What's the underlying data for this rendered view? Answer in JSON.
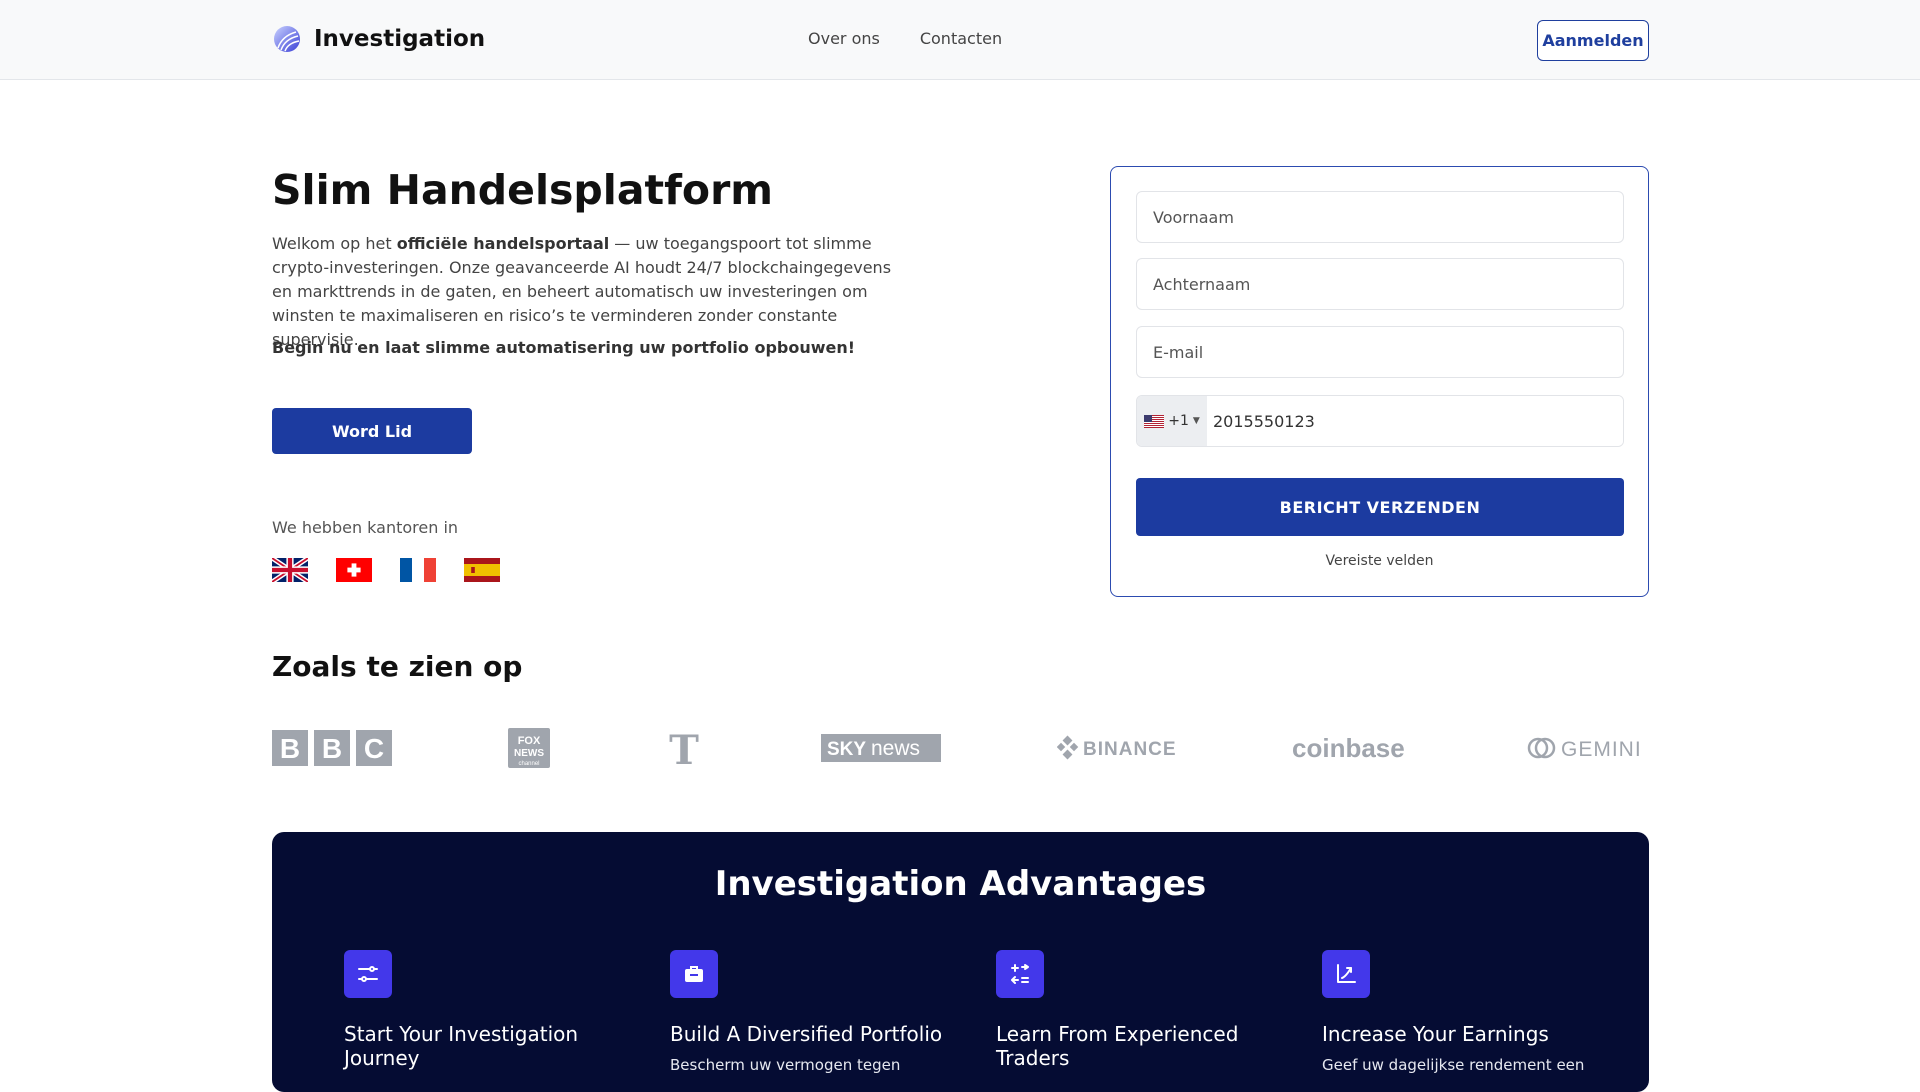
{
  "header": {
    "brand": "Investigation",
    "nav": [
      "Over ons",
      "Contacten"
    ],
    "login_label": "Aanmelden"
  },
  "hero": {
    "title": "Slim Handelsplatform",
    "intro_pre": "Welkom op het ",
    "intro_bold": "officiële handelsportaal",
    "intro_post": " — uw toegangspoort tot slimme crypto-investeringen. Onze geavanceerde AI houdt 24/7 blockchaingegevens en markttrends in de gaten, en beheert automatisch uw investeringen om winsten te maximaliseren en risico’s te verminderen zonder constante supervisie.",
    "cta_text": "Begin nu en laat slimme automatisering uw portfolio opbouwen!",
    "join_label": "Word Lid",
    "offices_label": "We hebben kantoren in"
  },
  "form": {
    "first_name_placeholder": "Voornaam",
    "last_name_placeholder": "Achternaam",
    "email_placeholder": "E-mail",
    "phone_code": "+1",
    "phone_value": "2015550123",
    "submit_label": "BERICHT VERZENDEN",
    "required_note": "Vereiste velden"
  },
  "seen_on": {
    "title": "Zoals te zien op",
    "logos": [
      "BBC",
      "FOX NEWS channel",
      "T",
      "SKY news",
      "BINANCE",
      "coinbase",
      "GEMINI"
    ]
  },
  "advantages": {
    "title": "Investigation Advantages",
    "items": [
      {
        "title": "Start Your Investigation Journey",
        "text": "",
        "icon": "sliders-icon"
      },
      {
        "title": "Build A Diversified Portfolio",
        "text": "Bescherm uw vermogen tegen",
        "icon": "briefcase-icon"
      },
      {
        "title": "Learn From Experienced Traders",
        "text": "",
        "icon": "exchange-icon"
      },
      {
        "title": "Increase Your Earnings",
        "text": "Geef uw dagelijkse rendement een",
        "icon": "growth-chart-icon"
      }
    ]
  },
  "colors": {
    "primary": "#1c3ba0",
    "dark_section": "#050c33",
    "icon_bg": "#4338ea"
  }
}
